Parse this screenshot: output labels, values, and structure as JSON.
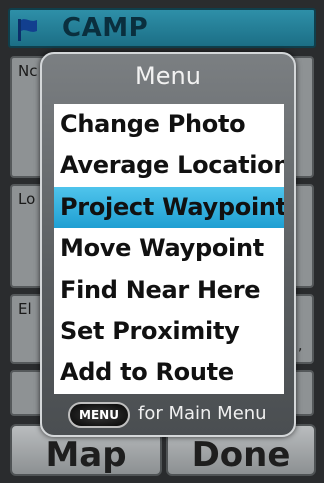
{
  "header": {
    "title": "CAMP",
    "icon": "flag-icon"
  },
  "fields": [
    {
      "label": "Nc"
    },
    {
      "label": "Lo"
    },
    {
      "label": "El"
    }
  ],
  "comma": ",",
  "buttons": {
    "map_label": "Map",
    "done_label": "Done"
  },
  "menu": {
    "title": "Menu",
    "items": [
      {
        "label": "Change Photo"
      },
      {
        "label": "Average Location"
      },
      {
        "label": "Project Waypoint",
        "selected": true
      },
      {
        "label": "Move Waypoint"
      },
      {
        "label": "Find Near Here"
      },
      {
        "label": "Set Proximity"
      },
      {
        "label": "Add to Route"
      }
    ],
    "footer": {
      "key_label": "MENU",
      "text": "for Main Menu"
    }
  },
  "colors": {
    "accent": "#1f9fd2",
    "title_bar": "#1c6f86"
  }
}
